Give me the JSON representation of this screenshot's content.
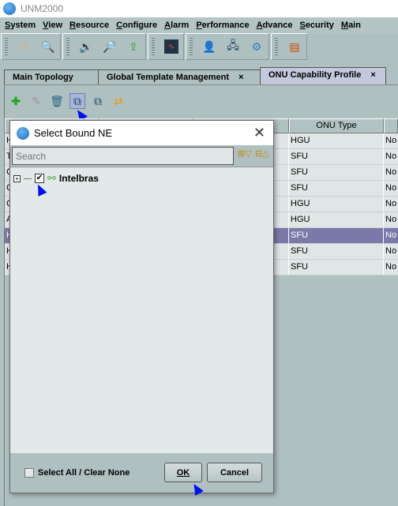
{
  "window": {
    "title": "UNM2000",
    "logo_text": "UNM"
  },
  "menu": [
    "System",
    "View",
    "Resource",
    "Configure",
    "Alarm",
    "Performance",
    "Advance",
    "Security",
    "Main"
  ],
  "toolbar_groups": [
    [
      "refresh-icon",
      "search-window-icon"
    ],
    [
      "speaker-icon",
      "alarm-search-icon",
      "find-upload-icon"
    ],
    [
      "monitor-chart-icon"
    ],
    [
      "user-monitor-icon",
      "network-icon",
      "gear-icon"
    ],
    [
      "window-icon"
    ]
  ],
  "tabs": [
    {
      "label": "Main Topology",
      "closable": false
    },
    {
      "label": "Global Template Management",
      "closable": true
    },
    {
      "label": "ONU Capability Profile",
      "closable": true,
      "active": true
    }
  ],
  "tab_close": "×",
  "content_toolbar": [
    "add-icon",
    "edit-icon",
    "delete-icon",
    "bind-ne-icon",
    "unbind-ne-icon",
    "sync-icon"
  ],
  "table": {
    "columns": [
      "",
      "",
      "",
      "ONU Type",
      ""
    ],
    "rows": [
      {
        "c0": "H",
        "type": "HGU",
        "c4": "No"
      },
      {
        "c0": "T",
        "type": "SFU",
        "c4": "No"
      },
      {
        "c0": "C",
        "type": "SFU",
        "c4": "No"
      },
      {
        "c0": "C",
        "type": "SFU",
        "c4": "No"
      },
      {
        "c0": "C",
        "type": "HGU",
        "c4": "No"
      },
      {
        "c0": "A",
        "type": "HGU",
        "c4": "No"
      },
      {
        "c0": "H",
        "type": "SFU",
        "c4": "No",
        "selected": true
      },
      {
        "c0": "H",
        "type": "SFU",
        "c4": "No"
      },
      {
        "c0": "H",
        "type": "SFU",
        "c4": "No"
      }
    ]
  },
  "dialog": {
    "title": "Select Bound NE",
    "close": "✕",
    "search_placeholder": "Search",
    "tree": [
      {
        "label": "Intelbras",
        "checked": true,
        "expanded": false
      }
    ],
    "select_all_label": "Select All / Clear None",
    "select_all_checked": false,
    "ok_label": "OK",
    "cancel_label": "Cancel"
  },
  "colors": {
    "background": "#afc0c0",
    "selected_row": "#7c79a9",
    "pointer": "#0010ee"
  }
}
